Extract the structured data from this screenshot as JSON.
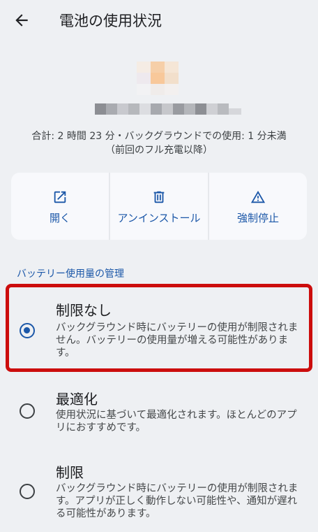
{
  "header": {
    "title": "電池の使用状況",
    "back_icon": "arrow-left-icon"
  },
  "usage": {
    "line1": "合計: 2 時間 23 分・バックグラウンドでの使用: 1 分未満",
    "line2": "（前回のフル充電以降）"
  },
  "actions": [
    {
      "label": "開く",
      "icon": "open-external-icon"
    },
    {
      "label": "アンインストール",
      "icon": "trash-icon"
    },
    {
      "label": "強制停止",
      "icon": "warning-icon"
    }
  ],
  "section": {
    "title": "バッテリー使用量の管理"
  },
  "options": [
    {
      "title": "制限なし",
      "description": "バックグラウンド時にバッテリーの使用が制限されません。バッテリーの使用量が増える可能性があります。",
      "selected": true
    },
    {
      "title": "最適化",
      "description": "使用状況に基づいて最適化されます。ほとんどのアプリにおすすめです。",
      "selected": false
    },
    {
      "title": "制限",
      "description": "バックグラウンド時にバッテリーの使用が制限されます。アプリが正しく動作しない可能性や、通知が遅れる可能性があります。",
      "selected": false
    }
  ],
  "colors": {
    "accent": "#1b57a8",
    "background": "#eef0f3",
    "card": "#f8f9fc",
    "highlight": "#cc0d0d"
  }
}
